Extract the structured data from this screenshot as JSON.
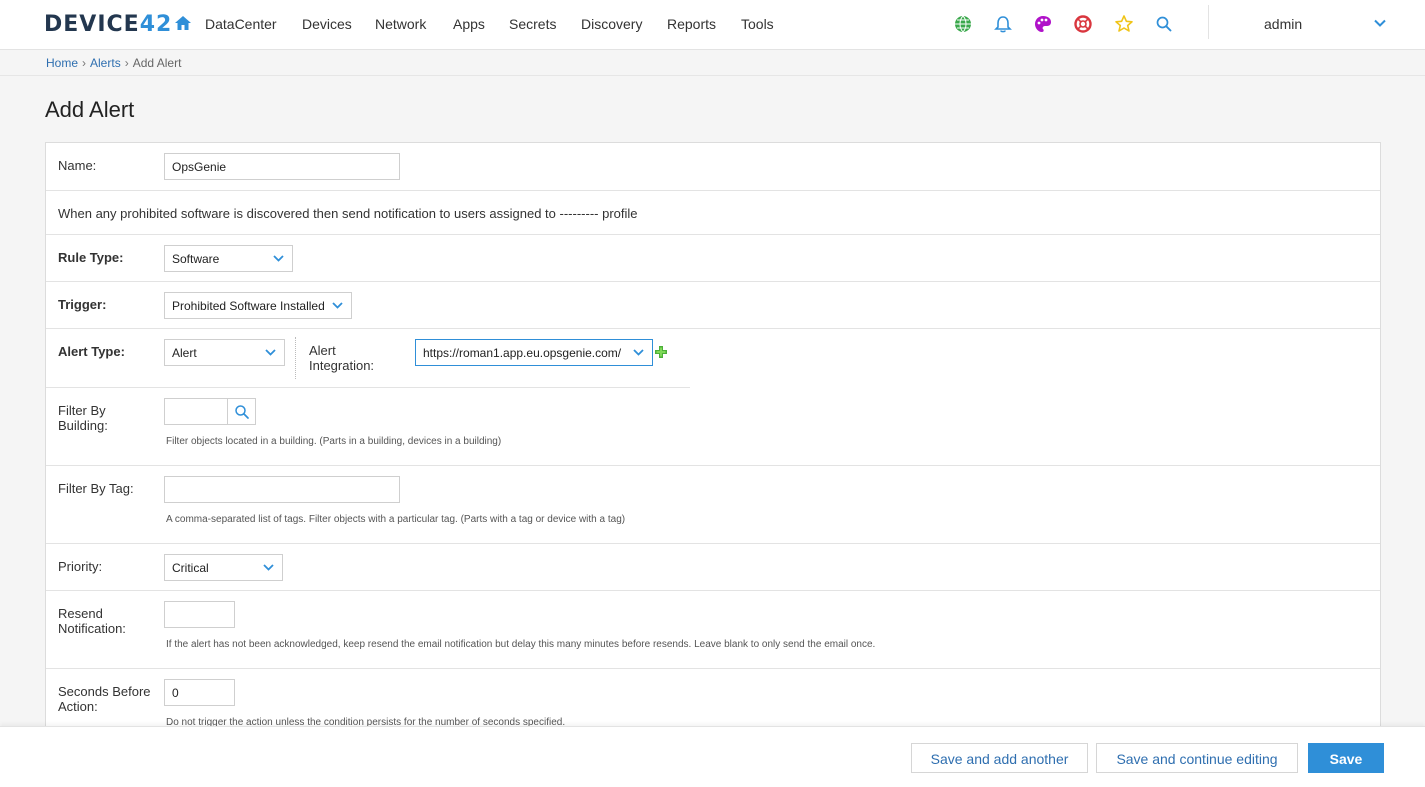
{
  "brand": {
    "logo_text": "DEVICE",
    "logo_num": "42"
  },
  "nav": {
    "items": [
      "DataCenter",
      "Devices",
      "Network",
      "Apps",
      "Secrets",
      "Discovery",
      "Reports",
      "Tools"
    ]
  },
  "user": {
    "name": "admin"
  },
  "breadcrumb": {
    "home": "Home",
    "alerts": "Alerts",
    "current": "Add Alert"
  },
  "page": {
    "title": "Add Alert"
  },
  "form": {
    "name": {
      "label": "Name:",
      "value": "OpsGenie"
    },
    "info": "When any prohibited software is discovered then send notification to users assigned to --------- profile",
    "rule_type": {
      "label": "Rule Type:",
      "value": "Software"
    },
    "trigger": {
      "label": "Trigger:",
      "value": "Prohibited Software Installed"
    },
    "alert_type": {
      "label": "Alert Type:",
      "value": "Alert"
    },
    "alert_integration": {
      "label_line1": "Alert",
      "label_line2": "Integration:",
      "value": "https://roman1.app.eu.opsgenie.com/"
    },
    "filter_building": {
      "label_line1": "Filter By",
      "label_line2": "Building:",
      "value": "",
      "help": "Filter objects located in a building. (Parts in a building, devices in a building)"
    },
    "filter_tag": {
      "label": "Filter By Tag:",
      "value": "",
      "help": "A comma-separated list of tags. Filter objects with a particular tag. (Parts with a tag or device with a tag)"
    },
    "priority": {
      "label": "Priority:",
      "value": "Critical"
    },
    "resend": {
      "label_line1": "Resend",
      "label_line2": "Notification:",
      "value": "",
      "help": "If the alert has not been acknowledged, keep resend the email notification but delay this many minutes before resends. Leave blank to only send the email once."
    },
    "seconds_before": {
      "label_line1": "Seconds Before",
      "label_line2": "Action:",
      "value": "0",
      "help": "Do not trigger the action unless the condition persists for the number of seconds specified."
    }
  },
  "footer": {
    "save_add_another": "Save and add another",
    "save_continue": "Save and continue editing",
    "save": "Save"
  },
  "colors": {
    "accent": "#2f8fd8",
    "link": "#2f6fb0",
    "globe": "#3aa84b",
    "bell": "#2f8fd8",
    "palette": "#b012c9",
    "help": "#d9363e",
    "star": "#f0c419"
  }
}
